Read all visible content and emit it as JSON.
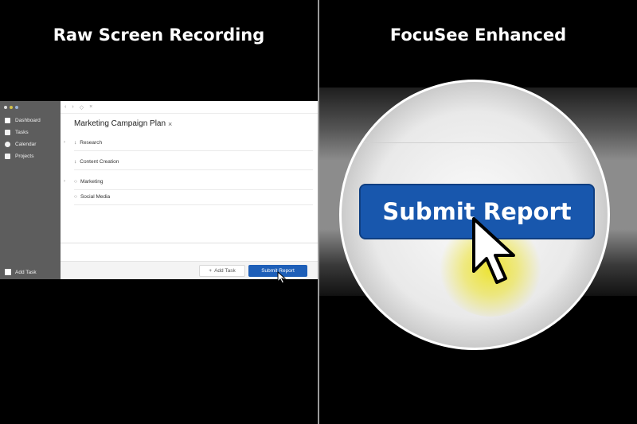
{
  "left_panel": {
    "heading": "Raw Screen Recording",
    "app": {
      "sidebar": {
        "items": [
          {
            "label": "Dashboard",
            "icon": "dashboard-icon"
          },
          {
            "label": "Tasks",
            "icon": "tasks-icon"
          },
          {
            "label": "Calendar",
            "icon": "calendar-icon"
          },
          {
            "label": "Projects",
            "icon": "projects-icon"
          }
        ],
        "add_task_label": "Add Task"
      },
      "toolbar": {
        "back": "‹",
        "forward": "›",
        "refresh": "◇",
        "close": "×"
      },
      "project_title": "Marketing Campaign Plan",
      "project_close": "×",
      "tasks": [
        {
          "label": "Research",
          "icon": "↕"
        },
        {
          "label": "Content Creation",
          "icon": "↕"
        },
        {
          "label": "Marketing",
          "icon": "○"
        },
        {
          "label": "Social Media",
          "icon": "○"
        }
      ],
      "footer": {
        "add_task_button": "Add Task",
        "add_task_icon": "+",
        "submit_button": "Submit Report"
      }
    }
  },
  "right_panel": {
    "heading": "FocuSee Enhanced",
    "zoom_button_label": "Submit Report"
  },
  "colors": {
    "background": "#000000",
    "sidebar": "#5d5d5d",
    "submit_blue": "#1e5fb8",
    "highlight_yellow": "#ece228"
  }
}
